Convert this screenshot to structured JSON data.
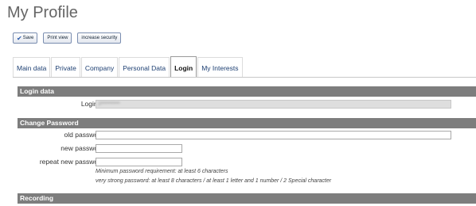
{
  "page": {
    "title": "My Profile"
  },
  "toolbar": {
    "save_label": "Save",
    "print_label": "Print view",
    "security_label": "increase security"
  },
  "tabs": [
    {
      "label": "Main data",
      "active": false
    },
    {
      "label": "Private",
      "active": false
    },
    {
      "label": "Company",
      "active": false
    },
    {
      "label": "Personal Data",
      "active": false
    },
    {
      "label": "Login",
      "active": true
    },
    {
      "label": "My Interests",
      "active": false
    }
  ],
  "sections": {
    "login_data": "Login data",
    "change_password": "Change Password",
    "recording": "Recording"
  },
  "login": {
    "label": "Login:",
    "value": "p•••••••••••"
  },
  "password": {
    "old_label": "old password:",
    "new_label": "new password:",
    "repeat_label": "repeat new password:",
    "old_value": "",
    "new_value": "",
    "repeat_value": ""
  },
  "notes": {
    "min_requirement": "Minimum password requirement: at least 6 characters",
    "strong_requirement": "very strong password: at least 8 characters / at least 1 letter and 1 number / 2 Special character"
  },
  "colors": {
    "section_header_bg": "#7d7d7d",
    "tab_text": "#1d3f72",
    "button_border": "#7a8db0"
  }
}
